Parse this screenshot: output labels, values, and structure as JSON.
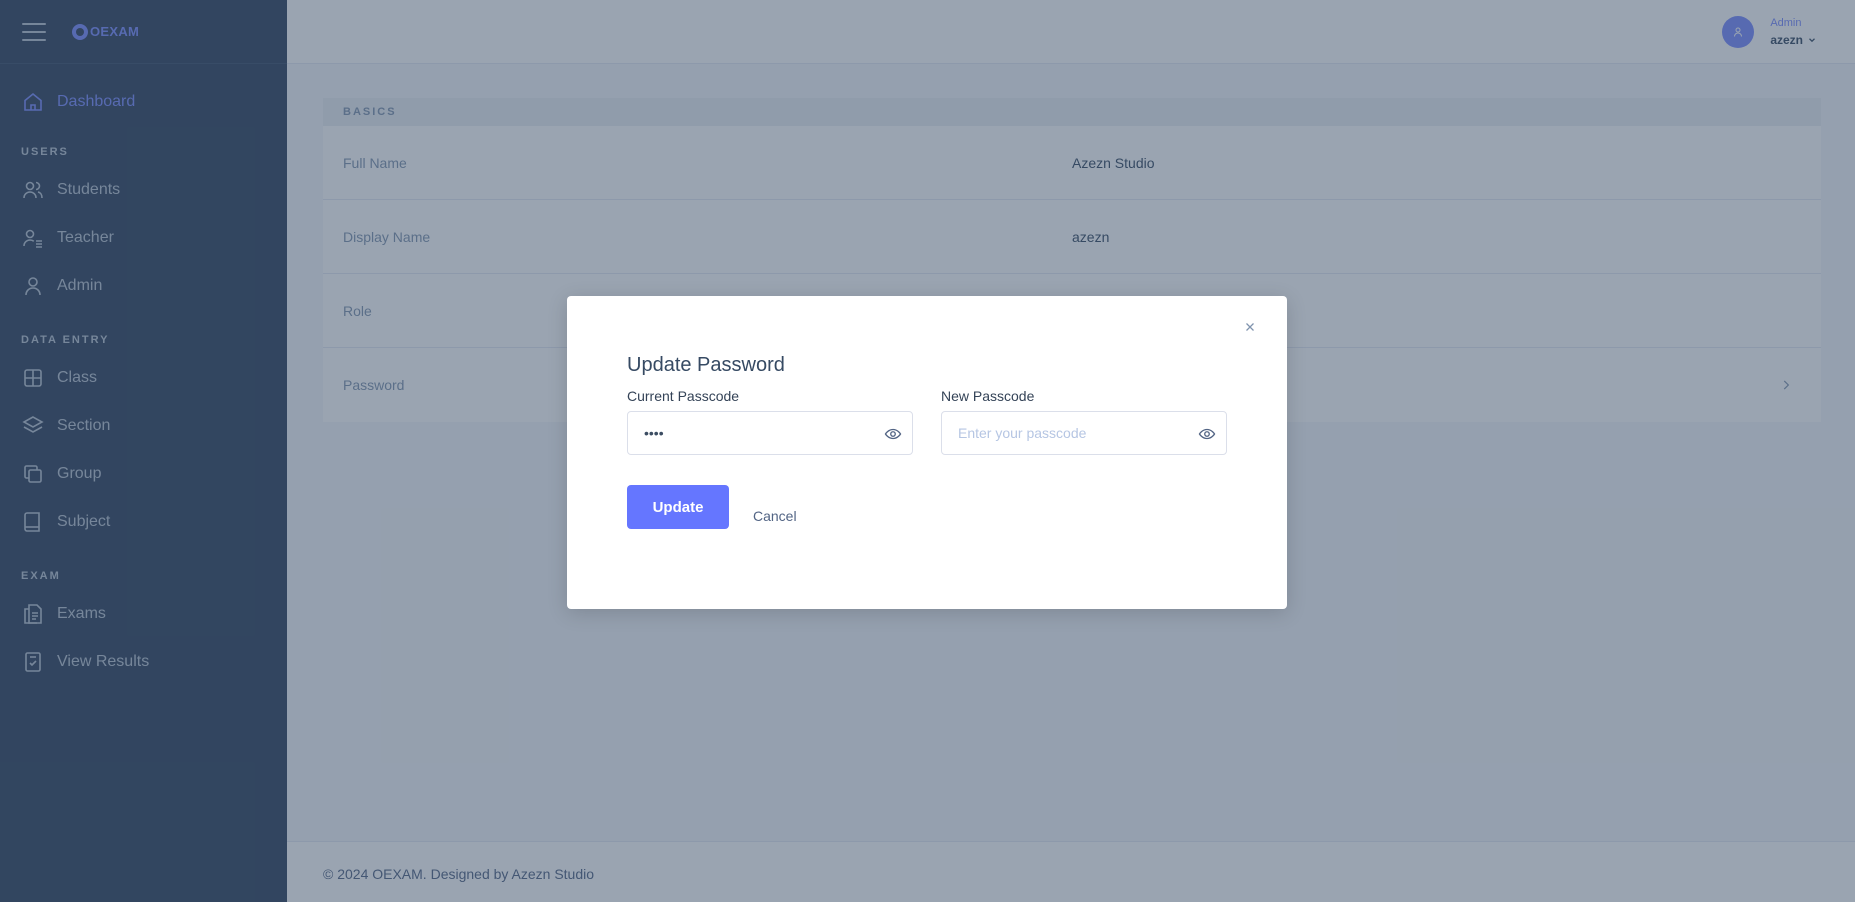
{
  "brand": {
    "logo_text": "OEXAM"
  },
  "sidebar": {
    "top_item": {
      "label": "Dashboard"
    },
    "sections": [
      {
        "heading": "USERS",
        "items": [
          {
            "label": "Students"
          },
          {
            "label": "Teacher"
          },
          {
            "label": "Admin"
          }
        ]
      },
      {
        "heading": "DATA ENTRY",
        "items": [
          {
            "label": "Class"
          },
          {
            "label": "Section"
          },
          {
            "label": "Group"
          },
          {
            "label": "Subject"
          }
        ]
      },
      {
        "heading": "EXAM",
        "items": [
          {
            "label": "Exams"
          },
          {
            "label": "View Results"
          }
        ]
      }
    ]
  },
  "header": {
    "user_role": "Admin",
    "user_name": "azezn"
  },
  "profile": {
    "section_heading": "BASICS",
    "rows": [
      {
        "label": "Full Name",
        "value": "Azezn Studio"
      },
      {
        "label": "Display Name",
        "value": "azezn"
      },
      {
        "label": "Role",
        "value": ""
      },
      {
        "label": "Password",
        "value": ""
      }
    ]
  },
  "footer": {
    "text": "© 2024 OEXAM. Designed by Azezn Studio"
  },
  "modal": {
    "title": "Update Password",
    "current": {
      "label": "Current Passcode",
      "value": "1234",
      "placeholder": ""
    },
    "new": {
      "label": "New Passcode",
      "value": "",
      "placeholder": "Enter your passcode"
    },
    "update_label": "Update",
    "cancel_label": "Cancel"
  },
  "colors": {
    "primary": "#6576ff",
    "sidebar_bg": "#2e415c",
    "accent": "#798bff"
  }
}
